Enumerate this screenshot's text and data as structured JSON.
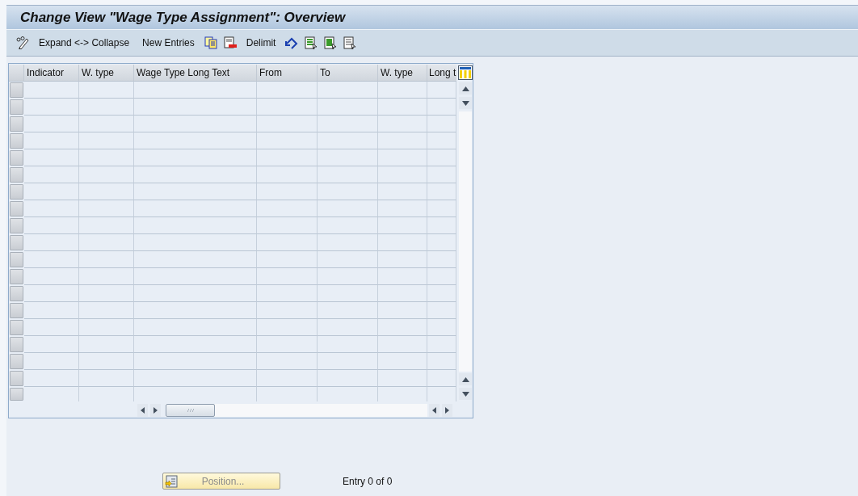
{
  "title": "Change View \"Wage Type Assignment\": Overview",
  "toolbar": [
    {
      "kind": "icon"
    },
    {
      "kind": "text",
      "label": "Expand <-> Collapse"
    },
    {
      "kind": "text",
      "label": "New Entries"
    },
    {
      "kind": "icon"
    },
    {
      "kind": "icon"
    },
    {
      "kind": "text",
      "label": "Delimit"
    },
    {
      "kind": "icon"
    },
    {
      "kind": "icon"
    },
    {
      "kind": "icon"
    },
    {
      "kind": "icon"
    }
  ],
  "table": {
    "columns": [
      "Indicator",
      "W. type",
      "Wage Type Long Text",
      "From",
      "To",
      "W. type",
      "Long t"
    ]
  },
  "position_button": {
    "label": "Position...",
    "disabled": true
  },
  "entry_count": "Entry 0 of 0"
}
